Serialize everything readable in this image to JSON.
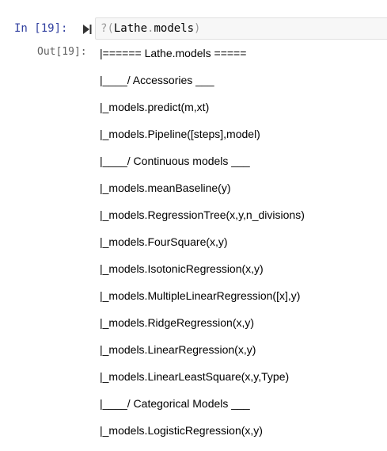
{
  "cell": {
    "in_prompt": "In [19]:",
    "code": {
      "prefix": "?",
      "open_paren": "(",
      "module": "Lathe",
      "dot": ".",
      "attr": "models",
      "close_paren": ")"
    },
    "out_prompt": "Out[19]:",
    "output": [
      "|====== Lathe.models =====",
      "|____/ Accessories ___",
      "|_models.predict(m,xt)",
      "|_models.Pipeline([steps],model)",
      "|____/ Continuous models ___",
      "|_models.meanBaseline(y)",
      "|_models.RegressionTree(x,y,n_divisions)",
      "|_models.FourSquare(x,y)",
      "|_models.IsotonicRegression(x,y)",
      "|_models.MultipleLinearRegression([x],y)",
      "|_models.RidgeRegression(x,y)",
      "|_models.LinearRegression(x,y)",
      "|_models.LinearLeastSquare(x,y,Type)",
      "|____/ Categorical Models ___",
      "|_models.LogisticRegression(x,y)"
    ]
  },
  "colors": {
    "in_prompt": "#303f9f",
    "out_prompt": "#616161",
    "input_bg": "#f7f7f7",
    "input_border": "#e0e0e0"
  },
  "icons": {
    "run": "run-cell-icon"
  }
}
